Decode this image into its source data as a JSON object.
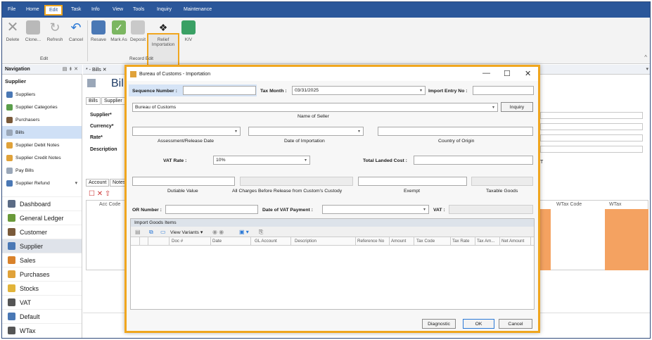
{
  "menu": [
    "File",
    "Home",
    "Edit",
    "Task",
    "Info",
    "View",
    "Tools",
    "Inquiry",
    "Maintenance"
  ],
  "ribbon": {
    "edit_buttons": [
      "Delete",
      "Clone...",
      "Refresh",
      "Cancel"
    ],
    "edit_group": "Edit",
    "record_buttons": [
      "Resave",
      "Mark As",
      "Deposit",
      "Relief\nImportation",
      "KIV"
    ],
    "record_group": "Record Edit"
  },
  "nav": {
    "header": "Navigation",
    "section": "Supplier",
    "items": [
      "Suppliers",
      "Supplier Categories",
      "Purchasers",
      "Bills",
      "Supplier Debit Notes",
      "Supplier Credit Notes",
      "Pay Bills",
      "Supplier Refund"
    ],
    "modules": [
      "Dashboard",
      "General Ledger",
      "Customer",
      "Supplier",
      "Sales",
      "Purchases",
      "Stocks",
      "VAT",
      "Default",
      "WTax"
    ]
  },
  "background": {
    "tab": "* - Bills",
    "title": "Bil",
    "subtabs": [
      "Bills",
      "Supplier"
    ],
    "labels": [
      "Supplier*",
      "Currency*",
      "Rate*",
      "Description"
    ],
    "grid_tabs": [
      "Account",
      "Notes"
    ],
    "col_acc": "Acc Code",
    "col_wtax_code": "WTax Code",
    "col_wtax": "WTax",
    "letter_t": "T"
  },
  "dialog": {
    "title": "Bureau of Customs - Importation",
    "sequence_label": "Sequence Number :",
    "sequence_value": "",
    "tax_month_label": "Tax Month :",
    "tax_month_value": "03/31/2025",
    "import_entry_label": "Import Entry No :",
    "import_entry_value": "",
    "seller_value": "Bureau of Customs",
    "inquiry_button": "Inquiry",
    "seller_caption": "Name of Seller",
    "assessment_caption": "Assessment/Release Date",
    "importation_caption": "Date of Importation",
    "country_caption": "Country of Origin",
    "vat_rate_label": "VAT Rate :",
    "vat_rate_value": "10%",
    "landed_cost_label": "Total Landed Cost :",
    "dutiable_caption": "Dutiable Value",
    "charges_caption": "All Charges Before Release from Custom's Custody",
    "exempt_caption": "Exempt",
    "taxable_caption": "Taxable Goods",
    "or_label": "OR Number :",
    "vat_payment_label": "Date of VAT Payment :",
    "vat_label": "VAT :",
    "import_goods_header": "Import Goods Items",
    "view_variants": "View Variants",
    "columns": [
      "Doc #",
      "Date",
      "GL Account",
      "Description",
      "Reference No",
      "Amount",
      "Tax Code",
      "Tax Rate",
      "Tax Am...",
      "Net Amount"
    ],
    "diagnostic_button": "Diagnostic",
    "ok_button": "OK",
    "cancel_button": "Cancel"
  }
}
